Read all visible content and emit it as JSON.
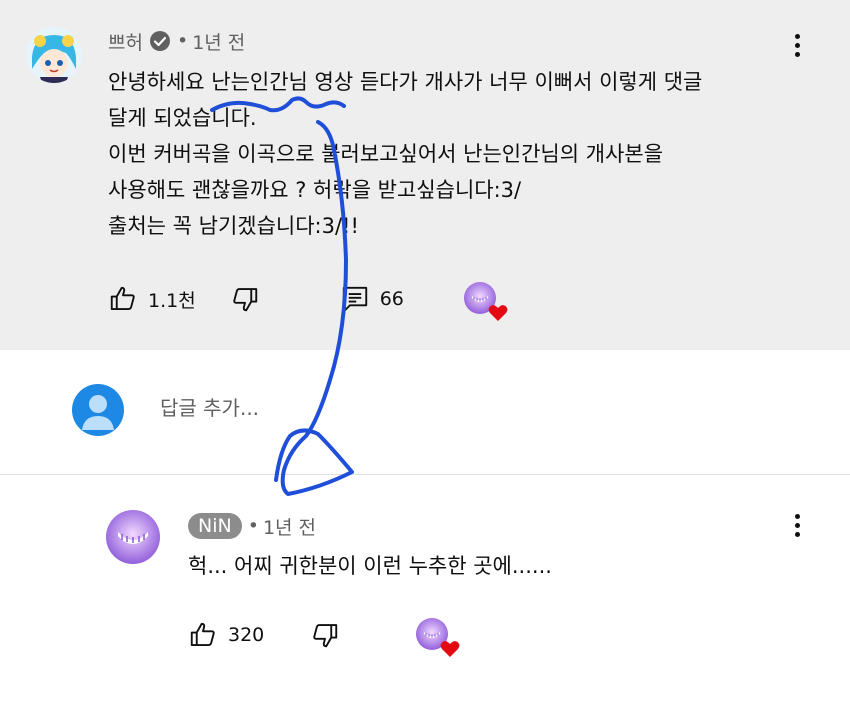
{
  "colors": {
    "highlight_bg": "#eeeeee",
    "meta_text": "#606060",
    "heart": "#e50914",
    "pen_ink": "#1f4fd8",
    "user_avatar": "#1e88e5",
    "author_chip": "#8c8c8c"
  },
  "top_comment": {
    "author": "쁘허",
    "verified_icon": "verified-check-icon",
    "separator": "•",
    "time": "1년 전",
    "lines": [
      "안녕하세요  난는인간님 영상 듣다가  개사가 너무 이뻐서  이렇게  댓글",
      "달게 되었습니다.",
      "이번 커버곡을 이곡으로  불러보고싶어서  난는인간님의  개사본을",
      "사용해도 괜찮을까요 ? 허락을 받고싶습니다:3/",
      "출처는 꼭 남기겠습니다:3/!!"
    ],
    "likes": "1.1천",
    "replies": "66",
    "icons": {
      "like": "thumbs-up-icon",
      "dislike": "thumbs-down-icon",
      "reply": "comment-icon",
      "menu": "more-vert-icon"
    }
  },
  "add_reply": {
    "placeholder": "답글 추가..."
  },
  "reply": {
    "author": "NiN",
    "separator": "•",
    "time": "1년 전",
    "text": "헉... 어찌 귀한분이 이런 누추한 곳에......",
    "likes": "320",
    "icons": {
      "like": "thumbs-up-icon",
      "dislike": "thumbs-down-icon",
      "menu": "more-vert-icon"
    }
  }
}
